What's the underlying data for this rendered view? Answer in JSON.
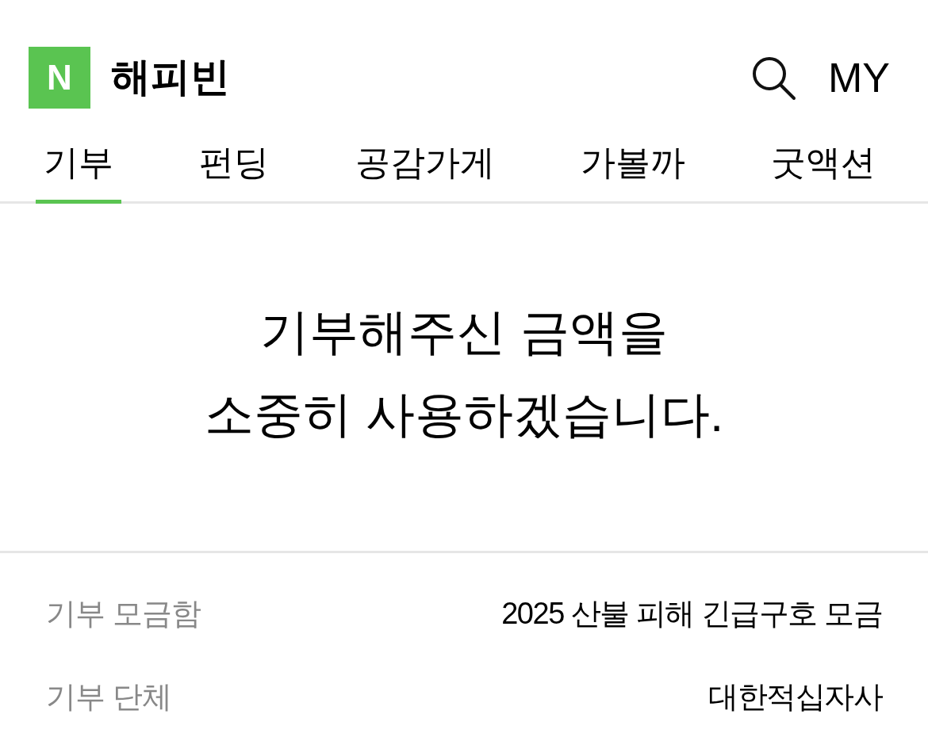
{
  "header": {
    "logo": "N",
    "title": "해피빈",
    "my": "MY"
  },
  "tabs": [
    {
      "label": "기부",
      "selected": true
    },
    {
      "label": "펀딩",
      "selected": false
    },
    {
      "label": "공감가게",
      "selected": false
    },
    {
      "label": "가볼까",
      "selected": false
    },
    {
      "label": "굿액션",
      "selected": false
    }
  ],
  "message": [
    "기부해주신 금액을",
    "소중히 사용하겠습니다."
  ],
  "details": [
    {
      "label": "기부 모금함",
      "value": "2025 산불 피해 긴급구호 모금"
    },
    {
      "label": "기부 단체",
      "value": "대한적십자사"
    }
  ]
}
